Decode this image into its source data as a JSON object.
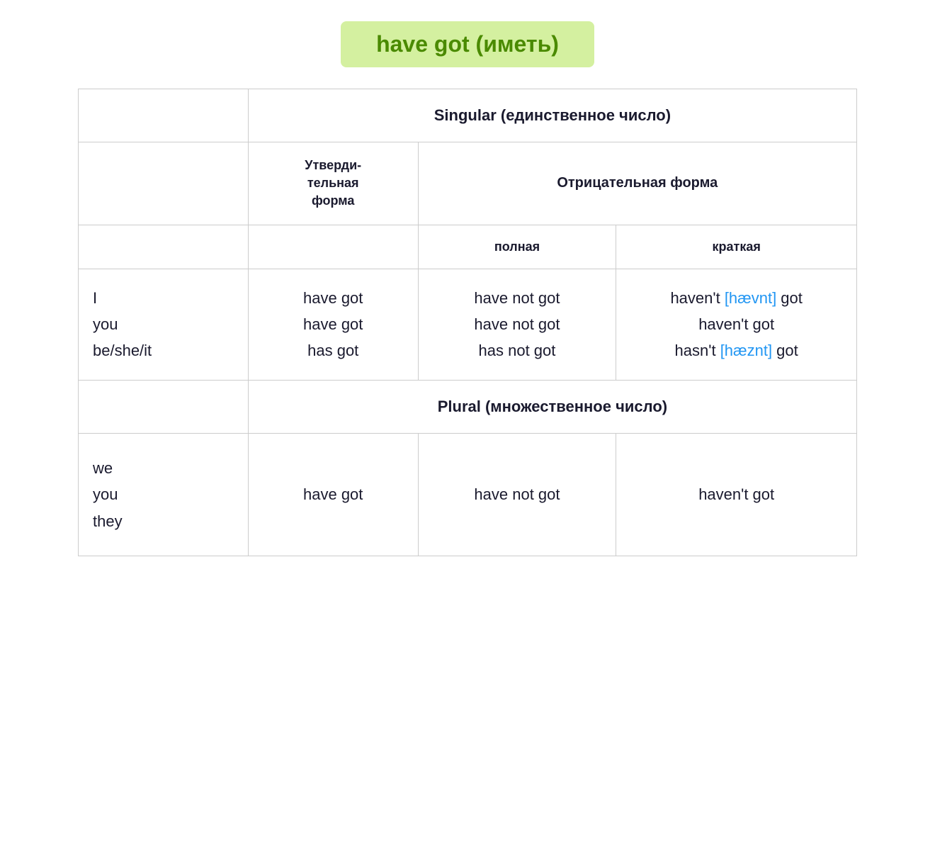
{
  "title": "have got (иметь)",
  "title_bg": "#d4f0a0",
  "singular_header": "Singular (единственное число)",
  "plural_header": "Plural (множественное число)",
  "affirm_label_line1": "Утверди-",
  "affirm_label_line2": "тельная",
  "affirm_label_line3": "форма",
  "negative_label": "Отрицательная форма",
  "polnaya_label": "полная",
  "kratkaya_label": "краткая",
  "singular_pronouns": "I\nyou\nbe/she/it",
  "singular_affirm": "have got\nhave got\nhas got",
  "singular_polnaya": "have not got\nhave not got\nhas not got",
  "singular_short_prefix1": "haven't ",
  "singular_short_phonetic1": "[hævnt]",
  "singular_short_suffix1": " got",
  "singular_short_line2": "haven't got",
  "singular_short_prefix3": "hasn't ",
  "singular_short_phonetic3": "[hæznt]",
  "singular_short_suffix3": " got",
  "plural_pronouns": "we\nyou\nthey",
  "plural_affirm": "have got",
  "plural_polnaya": "have not got",
  "plural_short": "haven't got"
}
